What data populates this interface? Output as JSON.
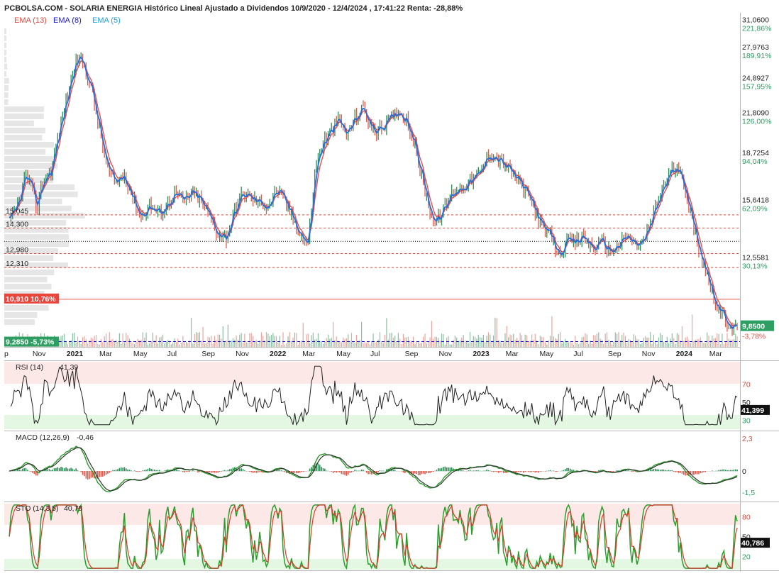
{
  "header": {
    "title": "PCBOLSA.COM - SOLARIA ENERGIA Histórico Lineal Ajustado a Dividendos 10/9/2020 - 12/4/2024 , 17:41:22 Renta: -28,88%",
    "legend": [
      {
        "label": "EMA (13)",
        "color": "#e8453c"
      },
      {
        "label": "EMA (8)",
        "color": "#1a1ad0"
      },
      {
        "label": "EMA (5)",
        "color": "#1aa3e8"
      }
    ]
  },
  "colors": {
    "up": "#2e8b57",
    "down": "#e05a4e",
    "blue_line": "#1f6fe0",
    "rsi_line": "#222222",
    "macd_line": "#2a9d2a",
    "signal_line": "#333333",
    "sto_k": "#2a9d2a",
    "sto_d": "#d83a2a",
    "overbought_zone": "#fde8e8",
    "oversold_zone": "#e3f7e3",
    "value_box": "#111111",
    "price_box": "#2e9e62",
    "red_box": "#e8453c",
    "low_box": "#2e9e62"
  },
  "chart_data": [
    {
      "type": "line",
      "title": "SOLARIA ENERGIA",
      "x_tick_labels": [
        "p",
        "Nov",
        "2021",
        "Mar",
        "May",
        "Jul",
        "Sep",
        "Nov",
        "2022",
        "Mar",
        "May",
        "Jul",
        "Sep",
        "Nov",
        "2023",
        "Mar",
        "May",
        "Jul",
        "Sep",
        "Nov",
        "2024",
        "Mar"
      ],
      "y_axis": {
        "log_scale": true,
        "range": [
          9.1,
          31.6
        ],
        "ticks": [
          {
            "value": 31.06,
            "label": "31,0600",
            "pct": "221,86%"
          },
          {
            "value": 27.9763,
            "label": "27,9763",
            "pct": "189,91%"
          },
          {
            "value": 24.8927,
            "label": "24,8927",
            "pct": "157,95%"
          },
          {
            "value": 21.809,
            "label": "21,8090",
            "pct": "126,00%"
          },
          {
            "value": 18.7254,
            "label": "18,7254",
            "pct": "94,04%"
          },
          {
            "value": 15.6418,
            "label": "15,6418",
            "pct": "62,09%"
          },
          {
            "value": 12.5581,
            "label": "12,5581",
            "pct": "30,13%"
          }
        ]
      },
      "levels": [
        {
          "value": 15.045,
          "label": "15,045",
          "style": "dashed-red"
        },
        {
          "value": 14.3,
          "label": "14,300",
          "style": "dashed-red"
        },
        {
          "value": 13.6,
          "label": "",
          "style": "dotted-black"
        },
        {
          "value": 12.98,
          "label": "12,980",
          "style": "dashed-red"
        },
        {
          "value": 12.31,
          "label": "12,310",
          "style": "dashed-red"
        },
        {
          "value": 10.91,
          "label": "10,910",
          "pct": "10,76%",
          "style": "solid-red"
        },
        {
          "value": 9.285,
          "label": "9,2850",
          "pct": "-5,73%",
          "style": "dashed-blue"
        }
      ],
      "last_price": {
        "value": 9.85,
        "label": "9,8500",
        "pct": "-3,78%"
      },
      "series": [
        {
          "name": "Precio",
          "points": [
            [
              "2020-09-10",
              14.6
            ],
            [
              "2020-09-25",
              15.6
            ],
            [
              "2020-10-10",
              17.6
            ],
            [
              "2020-10-20",
              16.6
            ],
            [
              "2020-10-30",
              15.4
            ],
            [
              "2020-11-10",
              17.2
            ],
            [
              "2020-11-25",
              17.9
            ],
            [
              "2020-12-08",
              20.6
            ],
            [
              "2020-12-20",
              23.0
            ],
            [
              "2021-01-05",
              26.6
            ],
            [
              "2021-01-12",
              27.5
            ],
            [
              "2021-01-20",
              26.9
            ],
            [
              "2021-02-05",
              24.1
            ],
            [
              "2021-02-20",
              20.5
            ],
            [
              "2021-03-05",
              17.9
            ],
            [
              "2021-03-20",
              16.9
            ],
            [
              "2021-04-05",
              17.6
            ],
            [
              "2021-04-20",
              16.0
            ],
            [
              "2021-05-05",
              14.9
            ],
            [
              "2021-05-20",
              15.6
            ],
            [
              "2021-06-05",
              15.1
            ],
            [
              "2021-06-20",
              15.6
            ],
            [
              "2021-07-05",
              16.4
            ],
            [
              "2021-07-20",
              15.8
            ],
            [
              "2021-08-05",
              16.4
            ],
            [
              "2021-08-20",
              15.9
            ],
            [
              "2021-09-05",
              14.9
            ],
            [
              "2021-09-20",
              14.0
            ],
            [
              "2021-10-05",
              13.8
            ],
            [
              "2021-10-20",
              15.3
            ],
            [
              "2021-11-05",
              16.4
            ],
            [
              "2021-11-20",
              16.0
            ],
            [
              "2021-12-05",
              15.7
            ],
            [
              "2021-12-20",
              15.6
            ],
            [
              "2022-01-05",
              16.6
            ],
            [
              "2022-01-20",
              15.7
            ],
            [
              "2022-02-05",
              14.6
            ],
            [
              "2022-02-20",
              13.8
            ],
            [
              "2022-03-01",
              13.4
            ],
            [
              "2022-03-08",
              15.8
            ],
            [
              "2022-03-15",
              18.2
            ],
            [
              "2022-03-25",
              19.6
            ],
            [
              "2022-04-10",
              20.6
            ],
            [
              "2022-04-25",
              21.6
            ],
            [
              "2022-05-10",
              20.3
            ],
            [
              "2022-05-25",
              21.9
            ],
            [
              "2022-06-10",
              22.6
            ],
            [
              "2022-06-25",
              20.6
            ],
            [
              "2022-07-10",
              20.9
            ],
            [
              "2022-07-25",
              21.6
            ],
            [
              "2022-08-10",
              22.4
            ],
            [
              "2022-08-25",
              21.6
            ],
            [
              "2022-09-05",
              20.2
            ],
            [
              "2022-09-15",
              18.3
            ],
            [
              "2022-10-01",
              15.9
            ],
            [
              "2022-10-15",
              14.5
            ],
            [
              "2022-11-01",
              15.4
            ],
            [
              "2022-11-15",
              16.4
            ],
            [
              "2022-12-01",
              16.7
            ],
            [
              "2022-12-20",
              17.2
            ],
            [
              "2023-01-05",
              17.6
            ],
            [
              "2023-01-20",
              19.1
            ],
            [
              "2023-02-05",
              18.6
            ],
            [
              "2023-02-20",
              18.1
            ],
            [
              "2023-03-10",
              17.3
            ],
            [
              "2023-03-25",
              16.5
            ],
            [
              "2023-04-10",
              15.6
            ],
            [
              "2023-04-25",
              14.3
            ],
            [
              "2023-05-10",
              13.9
            ],
            [
              "2023-05-25",
              12.9
            ],
            [
              "2023-06-10",
              13.6
            ],
            [
              "2023-06-25",
              13.5
            ],
            [
              "2023-07-10",
              13.9
            ],
            [
              "2023-07-25",
              13.2
            ],
            [
              "2023-08-10",
              13.6
            ],
            [
              "2023-08-25",
              13.1
            ],
            [
              "2023-09-10",
              13.4
            ],
            [
              "2023-09-25",
              13.9
            ],
            [
              "2023-10-10",
              13.4
            ],
            [
              "2023-10-25",
              13.6
            ],
            [
              "2023-11-10",
              14.9
            ],
            [
              "2023-11-25",
              16.4
            ],
            [
              "2023-12-10",
              17.6
            ],
            [
              "2023-12-20",
              18.0
            ],
            [
              "2024-01-05",
              17.1
            ],
            [
              "2024-01-20",
              14.6
            ],
            [
              "2024-02-05",
              12.9
            ],
            [
              "2024-02-20",
              11.6
            ],
            [
              "2024-03-05",
              10.6
            ],
            [
              "2024-03-15",
              10.2
            ],
            [
              "2024-03-25",
              10.0
            ],
            [
              "2024-04-05",
              9.7
            ],
            [
              "2024-04-12",
              9.85
            ]
          ]
        }
      ]
    },
    {
      "type": "line",
      "title": "RSI (14)",
      "value_label": "41,39",
      "last_box": "41,399",
      "y_ticks": [
        {
          "value": 70,
          "label": "70"
        },
        {
          "value": 50,
          "label": "50"
        },
        {
          "value": 30,
          "label": "30"
        }
      ],
      "y_range": [
        20,
        95
      ]
    },
    {
      "type": "line",
      "title": "MACD (12,26,9)",
      "value_label": "-0,46",
      "y_ticks": [
        {
          "value": 2.3,
          "label": "2,3"
        },
        {
          "value": 0,
          "label": "0"
        },
        {
          "value": -1.5,
          "label": "-1,5"
        }
      ],
      "y_range": [
        -1.8,
        2.6
      ]
    },
    {
      "type": "line",
      "title": "STO (14,3,5)",
      "value_label": "40,78",
      "last_box": "40,786",
      "y_ticks": [
        {
          "value": 80,
          "label": "80"
        },
        {
          "value": 50,
          "label": "50"
        },
        {
          "value": 20,
          "label": "20"
        }
      ],
      "y_range": [
        0,
        100
      ]
    }
  ]
}
